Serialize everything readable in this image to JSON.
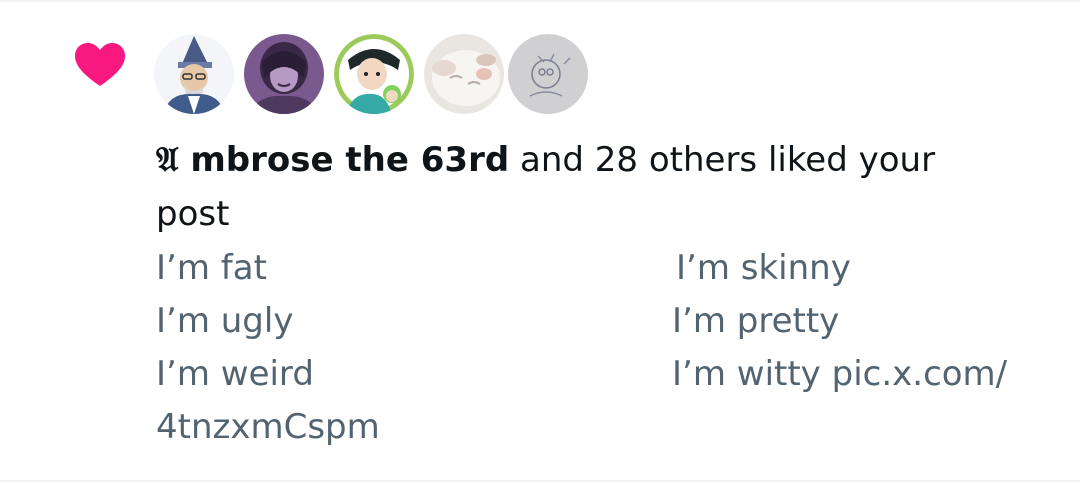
{
  "notification": {
    "type_icon": "heart-icon",
    "accent_color": "#f91880",
    "avatars": [
      {
        "icon": "wizard-avatar"
      },
      {
        "icon": "purple-character-avatar"
      },
      {
        "icon": "anime-characters-avatar"
      },
      {
        "icon": "white-cat-avatar"
      },
      {
        "icon": "sketch-avatar"
      }
    ],
    "actor_name": "𝔄 mbrose the 63rd",
    "action_text": " and 28 others liked your post",
    "post_preview": {
      "left_lines": [
        "I’m fat",
        "I’m ugly",
        "I’m weird",
        "4tnzxmCspm"
      ],
      "right_lines": [
        "I’m skinny",
        "I’m pretty",
        "I’m witty pic.x.com/"
      ]
    }
  }
}
